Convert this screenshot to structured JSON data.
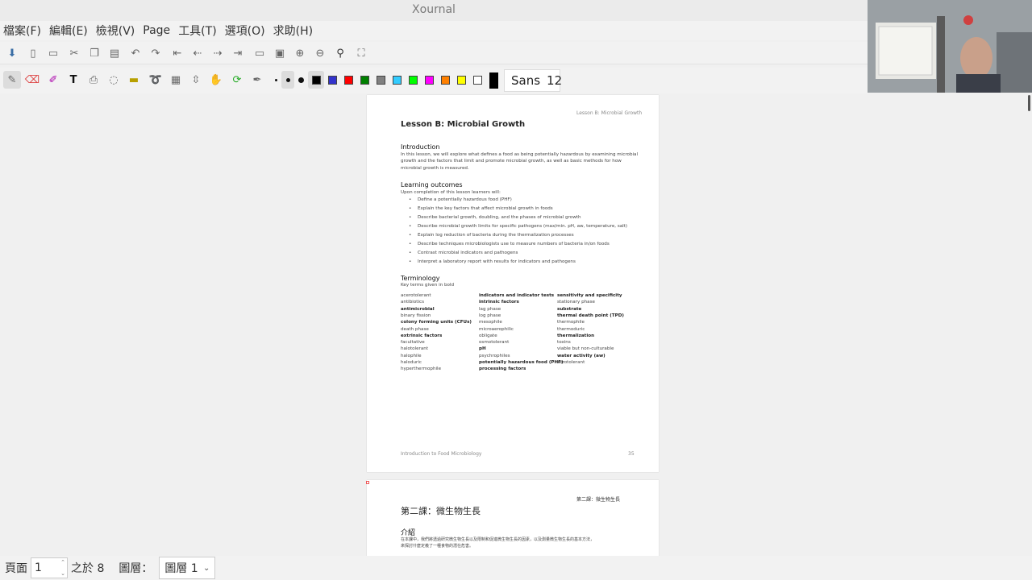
{
  "window": {
    "title": "Xournal"
  },
  "menu": [
    "檔案(F)",
    "編輯(E)",
    "檢視(V)",
    "Page",
    "工具(T)",
    "選項(O)",
    "求助(H)"
  ],
  "toolbar_top_icons": [
    "save-icon",
    "new-page-icon",
    "open-icon",
    "cut-icon",
    "copy-icon",
    "paste-icon",
    "undo-icon",
    "redo-icon",
    "first-page-icon",
    "prev-page-icon",
    "next-page-icon",
    "last-page-icon",
    "page-width-icon",
    "zoom-out-icon",
    "zoom-in-icon",
    "zoom-fit-icon",
    "zoom-icon",
    "fullscreen-icon"
  ],
  "toolbar_tools": [
    "pen-icon",
    "eraser-icon",
    "highlighter-icon",
    "text-icon",
    "image-icon",
    "select-region-icon",
    "ruler-icon",
    "lasso-icon",
    "select-rect-icon",
    "vertical-space-icon",
    "hand-icon",
    "shape-recognizer-icon",
    "pen-settings-icon"
  ],
  "colors": [
    "#000000",
    "#3333cc",
    "#ff0000",
    "#008000",
    "#808080",
    "#33ccff",
    "#00ff00",
    "#ff00ff",
    "#ff8000",
    "#ffff00",
    "#ffffff"
  ],
  "font": {
    "name": "Sans",
    "size": "12"
  },
  "page1": {
    "running_header": "Lesson B: Microbial Growth",
    "title": "Lesson B: Microbial Growth",
    "intro_heading": "Introduction",
    "intro_lines": [
      "In this lesson, we will explore what defines a food as being potentially hazardous by examining microbial",
      "growth and the factors that limit and promote microbial growth, as well as basic methods for how",
      "microbial growth is measured."
    ],
    "outcomes_heading": "Learning outcomes",
    "outcomes_intro": "Upon completion of this lesson learners will:",
    "outcomes": [
      "Define a potentially hazardous food (PHF)",
      "Explain the key factors that affect microbial growth in foods",
      "Describe bacterial growth, doubling, and the phases of microbial growth",
      "Describe microbial growth limits for specific pathogens (max/min. pH, aw, temperature, salt)",
      "Explain log reduction of bacteria during the thermalization processes",
      "Describe techniques microbiologists use to measure numbers of bacteria in/on foods",
      "Contrast microbial indicators and pathogens",
      "Interpret a laboratory report with results for indicators and pathogens"
    ],
    "terminology_heading": "Terminology",
    "terminology_intro": "Key terms given in bold",
    "terms_col1": [
      {
        "t": "acerotolerant",
        "b": false
      },
      {
        "t": "antibiotics",
        "b": false
      },
      {
        "t": "antimicrobial",
        "b": true
      },
      {
        "t": "binary fission",
        "b": false
      },
      {
        "t": "colony forming units (CFUs)",
        "b": true
      },
      {
        "t": "death phase",
        "b": false
      },
      {
        "t": "extrinsic factors",
        "b": true
      },
      {
        "t": "facultative",
        "b": false
      },
      {
        "t": "halotolerant",
        "b": false
      },
      {
        "t": "halophile",
        "b": false
      },
      {
        "t": "haloduric",
        "b": false
      },
      {
        "t": "hyperthermophile",
        "b": false
      }
    ],
    "terms_col2": [
      {
        "t": "indicators and indicator tests",
        "b": true
      },
      {
        "t": "intrinsic factors",
        "b": true
      },
      {
        "t": "lag phase",
        "b": false
      },
      {
        "t": "log phase",
        "b": false
      },
      {
        "t": "mesophile",
        "b": false
      },
      {
        "t": "microaerophilic",
        "b": false
      },
      {
        "t": "obligate",
        "b": false
      },
      {
        "t": "osmotolerant",
        "b": false
      },
      {
        "t": "pH",
        "b": true
      },
      {
        "t": "psychrophiles",
        "b": false
      },
      {
        "t": "potentially hazardous food (PHF)",
        "b": true
      },
      {
        "t": "processing factors",
        "b": true
      }
    ],
    "terms_col3": [
      {
        "t": "sensitivity and specificity",
        "b": true
      },
      {
        "t": "stationary phase",
        "b": false
      },
      {
        "t": "substrate",
        "b": true
      },
      {
        "t": "thermal death point (TPD)",
        "b": true
      },
      {
        "t": "thermophile",
        "b": false
      },
      {
        "t": "thermoduric",
        "b": false
      },
      {
        "t": "thermalization",
        "b": true
      },
      {
        "t": "toxins",
        "b": false
      },
      {
        "t": "viable but non-culturable",
        "b": false
      },
      {
        "t": "water activity (aw)",
        "b": true
      },
      {
        "t": "xerotolerant",
        "b": false
      }
    ],
    "footer_left": "Introduction to Food Microbiology",
    "footer_right": "35"
  },
  "page2": {
    "running_header": "第二課：微生物生長",
    "title": "第二課：微生物生長",
    "intro_heading": "介紹",
    "intro_lines": [
      "在本課中，我們將透過研究微生物生長以及限制和促進微生物生長的因素，以及測量微生物生長的基本方法，",
      "來探討什麼定義了一種食物的潛在危害。"
    ]
  },
  "status": {
    "page_label": "頁面",
    "page_value": "1",
    "of_label": "之於 8",
    "layer_label": "圖層：",
    "layer_value": "圖層 1"
  }
}
